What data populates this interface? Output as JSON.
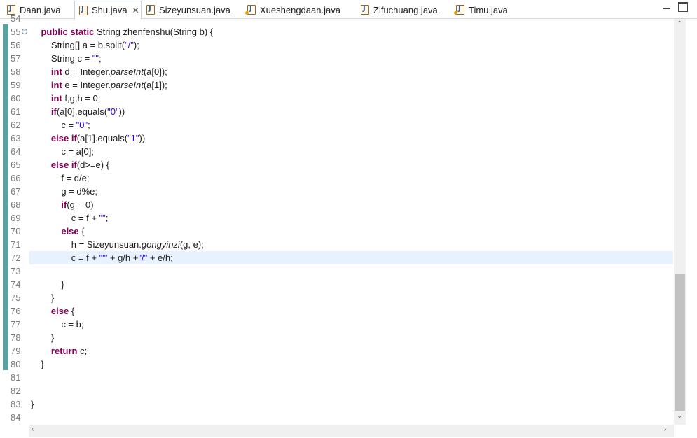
{
  "tabs": [
    {
      "label": "Daan.java",
      "active": false,
      "modified": false
    },
    {
      "label": "Shu.java",
      "active": true,
      "modified": false
    },
    {
      "label": "Sizeyunsuan.java",
      "active": false,
      "modified": false
    },
    {
      "label": "Xueshengdaan.java",
      "active": false,
      "modified": true
    },
    {
      "label": "Zifuchuang.java",
      "active": false,
      "modified": false
    },
    {
      "label": "Timu.java",
      "active": false,
      "modified": true
    }
  ],
  "window_controls": {
    "minimize_icon": "minimize-icon",
    "maximize_icon": "maximize-icon"
  },
  "editor": {
    "current_line": "72",
    "line_numbers": [
      "54",
      "55",
      "56",
      "57",
      "58",
      "59",
      "60",
      "61",
      "62",
      "63",
      "64",
      "65",
      "66",
      "67",
      "68",
      "69",
      "70",
      "71",
      "72",
      "73",
      "74",
      "75",
      "76",
      "77",
      "78",
      "79",
      "80",
      "81",
      "82",
      "83",
      "84"
    ],
    "lines": [
      "",
      "    public static String zhenfenshu(String b) {",
      "        String[] a = b.split(\"/\");",
      "        String c = \"\";",
      "        int d = Integer.parseInt(a[0]);",
      "        int e = Integer.parseInt(a[1]);",
      "        int f,g,h = 0;",
      "        if(a[0].equals(\"0\"))",
      "            c = \"0\";",
      "        else if(a[1].equals(\"1\"))",
      "            c = a[0];",
      "        else if(d>=e) {",
      "            f = d/e;",
      "            g = d%e;",
      "            if(g==0)",
      "                c = f + \"\";",
      "            else {",
      "                h = Sizeyunsuan.gongyinzi(g, e);",
      "                c = f + \"'\" + g/h +\"/\" + e/h;",
      "",
      "            }",
      "        }",
      "        else {",
      "            c = b;",
      "        }",
      "        return c;",
      "    }",
      "",
      "",
      "}",
      ""
    ]
  }
}
